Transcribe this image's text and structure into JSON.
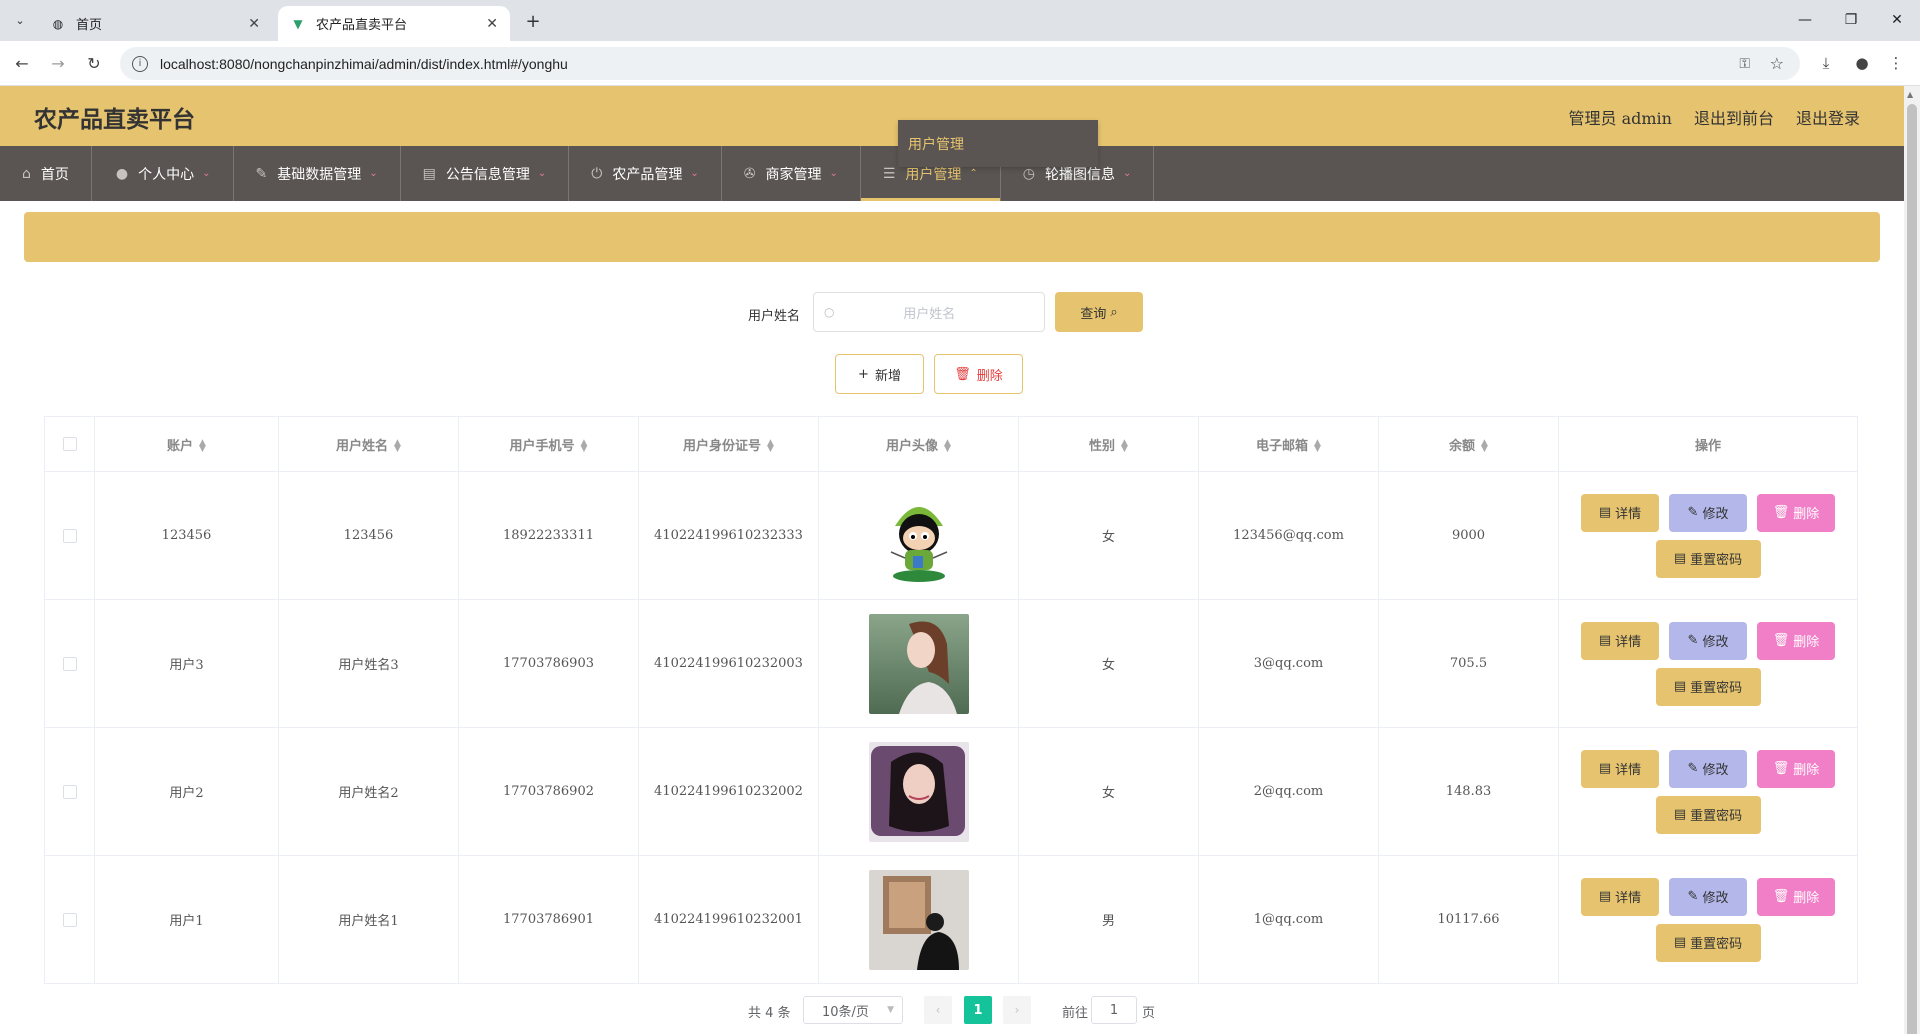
{
  "browser": {
    "tabs": [
      {
        "title": "首页",
        "active": false
      },
      {
        "title": "农产品直卖平台",
        "active": true
      }
    ],
    "url": "localhost:8080/nongchanpinzhimai/admin/dist/index.html#/yonghu"
  },
  "header": {
    "brand": "农产品直卖平台",
    "admin": "管理员 admin",
    "to_front": "退出到前台",
    "logout": "退出登录"
  },
  "nav": {
    "items": [
      {
        "label": "首页",
        "icon": "home-icon"
      },
      {
        "label": "个人中心",
        "icon": "user-icon"
      },
      {
        "label": "基础数据管理",
        "icon": "edit-icon"
      },
      {
        "label": "公告信息管理",
        "icon": "clipboard-icon"
      },
      {
        "label": "农产品管理",
        "icon": "power-icon"
      },
      {
        "label": "商家管理",
        "icon": "compass-icon"
      },
      {
        "label": "用户管理",
        "icon": "sliders-icon"
      },
      {
        "label": "轮播图信息",
        "icon": "clock-icon"
      }
    ],
    "dropdown_item": "用户管理"
  },
  "search": {
    "label": "用户姓名",
    "placeholder": "用户姓名",
    "query_button": "查询"
  },
  "actions": {
    "add": "新增",
    "delete": "删除"
  },
  "table": {
    "columns": [
      "账户",
      "用户姓名",
      "用户手机号",
      "用户身份证号",
      "用户头像",
      "性别",
      "电子邮箱",
      "余额",
      "操作"
    ],
    "rows": [
      {
        "account": "123456",
        "name": "123456",
        "phone": "18922233311",
        "id_no": "410224199610232333",
        "gender": "女",
        "email": "123456@qq.com",
        "balance": "9000"
      },
      {
        "account": "用户3",
        "name": "用户姓名3",
        "phone": "17703786903",
        "id_no": "410224199610232003",
        "gender": "女",
        "email": "3@qq.com",
        "balance": "705.5"
      },
      {
        "account": "用户2",
        "name": "用户姓名2",
        "phone": "17703786902",
        "id_no": "410224199610232002",
        "gender": "女",
        "email": "2@qq.com",
        "balance": "148.83"
      },
      {
        "account": "用户1",
        "name": "用户姓名1",
        "phone": "17703786901",
        "id_no": "410224199610232001",
        "gender": "男",
        "email": "1@qq.com",
        "balance": "10117.66"
      }
    ],
    "op_labels": {
      "detail": "详情",
      "edit": "修改",
      "remove": "删除",
      "reset": "重置密码"
    }
  },
  "pager": {
    "total": "共 4 条",
    "page_size": "10条/页",
    "current_page": "1",
    "goto_label": "前往",
    "goto_value": "1",
    "page_word": "页"
  },
  "colors": {
    "accent": "#e6c46f",
    "nav_bg": "#5a5553",
    "edit_btn": "#b3b7e9",
    "remove_btn": "#f07fc7",
    "page_active": "#15c39a"
  }
}
